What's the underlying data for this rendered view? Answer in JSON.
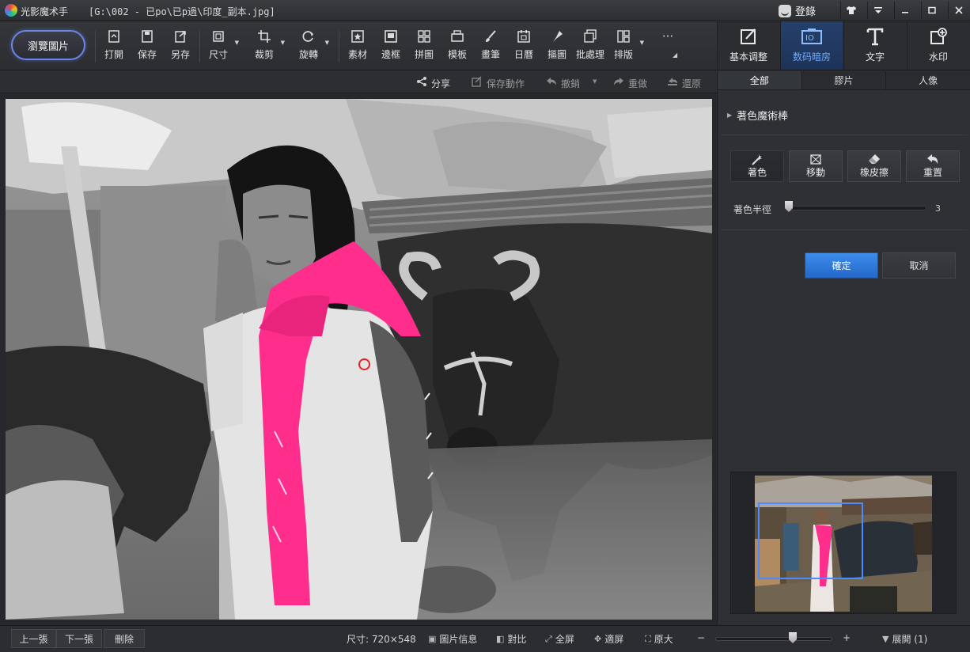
{
  "window": {
    "app_name": "光影魔术手",
    "path": "[G:\\002 - 已po\\已p過\\印度_副本.jpg]",
    "login_label": "登錄",
    "controls": [
      "shirt-icon",
      "menu-icon",
      "minimize-icon",
      "maximize-icon",
      "close-icon"
    ]
  },
  "toolbar": {
    "browse_label": "瀏覽圖片",
    "tools": [
      {
        "label": "打開",
        "icon": "open-icon"
      },
      {
        "label": "保存",
        "icon": "save-icon"
      },
      {
        "label": "另存",
        "icon": "save-as-icon"
      },
      {
        "label": "尺寸",
        "icon": "resize-icon"
      },
      {
        "label": "裁剪",
        "icon": "crop-icon"
      },
      {
        "label": "旋轉",
        "icon": "rotate-icon"
      },
      {
        "label": "素材",
        "icon": "material-icon"
      },
      {
        "label": "邊框",
        "icon": "border-icon"
      },
      {
        "label": "拼圖",
        "icon": "collage-icon"
      },
      {
        "label": "模板",
        "icon": "template-icon"
      },
      {
        "label": "畫筆",
        "icon": "brush-icon"
      },
      {
        "label": "日曆",
        "icon": "calendar-icon"
      },
      {
        "label": "摳圖",
        "icon": "cutout-icon"
      },
      {
        "label": "批處理",
        "icon": "batch-icon"
      },
      {
        "label": "排版",
        "icon": "layout-icon"
      }
    ],
    "more_label": "···"
  },
  "modes": [
    {
      "label": "基本调整",
      "icon": "basic-adjust-icon",
      "active": false
    },
    {
      "label": "数码暗房",
      "icon": "darkroom-icon",
      "active": true
    },
    {
      "label": "文字",
      "icon": "text-icon",
      "active": false
    },
    {
      "label": "水印",
      "icon": "watermark-icon",
      "active": false
    }
  ],
  "actions": {
    "share": "分享",
    "save_action": "保存動作",
    "undo": "撤銷",
    "redo": "重做",
    "restore": "還原"
  },
  "panel": {
    "tabs": [
      "全部",
      "膠片",
      "人像"
    ],
    "section_title": "著色魔術棒",
    "brush_buttons": [
      {
        "label": "著色",
        "icon": "color-wand-icon",
        "active": true
      },
      {
        "label": "移動",
        "icon": "move-icon",
        "active": false
      },
      {
        "label": "橡皮擦",
        "icon": "eraser-icon",
        "active": false
      },
      {
        "label": "重置",
        "icon": "reset-icon",
        "active": false
      }
    ],
    "radius_label": "著色半徑",
    "radius_value": "3",
    "confirm_label": "確定",
    "cancel_label": "取消"
  },
  "statusbar": {
    "prev": "上一張",
    "next": "下一張",
    "delete": "刪除",
    "size": "尺寸: 720×548",
    "image_info": "圖片信息",
    "compare": "對比",
    "fullscreen": "全屏",
    "fit": "適屏",
    "original": "原大",
    "zoom_minus": "−",
    "zoom_plus": "+",
    "expand": "展開 (1)"
  },
  "colors": {
    "accent": "#2f7fe0",
    "scarf": "#ff2d8c",
    "active_mode": "#1e3358"
  }
}
